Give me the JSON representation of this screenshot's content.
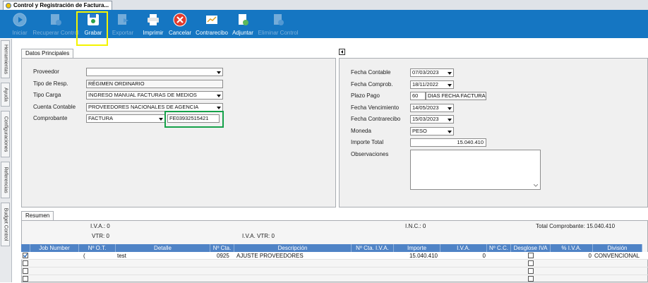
{
  "window": {
    "title": "Control y Registración de Factura..."
  },
  "toolbar": {
    "iniciar": "Iniciar",
    "recuperar": "Recuperar Control",
    "grabar": "Grabar",
    "exportar": "Exportar",
    "imprimir": "Imprimir",
    "cancelar": "Cancelar",
    "contrarecibo": "Contrarecibo",
    "adjuntar": "Adjuntar",
    "eliminar": "Eliminar Control"
  },
  "side_tabs": [
    "Herramientas",
    "Ayuda",
    "Configuraciones",
    "Referencias",
    "Budget Control"
  ],
  "datos": {
    "tab": "Datos Principales",
    "proveedor_label": "Proveedor",
    "proveedor_value": "",
    "tipo_resp_label": "Tipo de Resp.",
    "tipo_resp_value": "RÉGIMEN ORDINARIO",
    "tipo_carga_label": "Tipo Carga",
    "tipo_carga_value": "INGRESO MANUAL FACTURAS DE MEDIOS",
    "cuenta_label": "Cuenta Contable",
    "cuenta_value": "PROVEEDORES NACIONALES DE AGENCIA",
    "comprobante_label": "Comprobante",
    "comprobante_tipo": "FACTURA",
    "comprobante_numero": "FE03932515421"
  },
  "fechas": {
    "fecha_contable_label": "Fecha Contable",
    "fecha_contable": "07/03/2023",
    "fecha_comprob_label": "Fecha Comprob.",
    "fecha_comprob": "18/11/2022",
    "plazo_label": "Plazo Pago",
    "plazo_dias": "60",
    "plazo_desc": "DIAS FECHA FACTURA",
    "vencimiento_label": "Fecha Vencimiento",
    "vencimiento": "14/05/2023",
    "contrarecibo_label": "Fecha Contrarecibo",
    "contrarecibo": "15/03/2023",
    "moneda_label": "Moneda",
    "moneda": "PESO",
    "importe_label": "Importe Total",
    "importe": "15.040.410",
    "observaciones_label": "Observaciones",
    "observaciones": ""
  },
  "resumen": {
    "tab": "Resumen",
    "iva": "I.V.A.: 0",
    "inc": "I.N.C.: 0",
    "total": "Total Comprobante: 15.040.410",
    "vtr": "VTR: 0",
    "iva_vtr": "I.V.A. VTR: 0"
  },
  "grid": {
    "columns": [
      "Job Number",
      "Nº O.T.",
      "Detalle",
      "Nº Cta.",
      "Descripción",
      "Nº Cta. I.V.A.",
      "Importe",
      "I.V.A.",
      "Nº C.C.",
      "Desglose IVA",
      "% I.V.A.",
      "División"
    ],
    "rows": [
      {
        "checked": true,
        "job_number": "",
        "ot": "(",
        "detalle": "test",
        "cta": "0925",
        "descripcion": "AJUSTE PROVEEDORES",
        "cta_iva": "",
        "importe": "15.040.410",
        "iva": "0",
        "cc": "",
        "desglose": false,
        "porc_iva": "0",
        "division": "CONVENCIONAL"
      },
      {
        "checked": false
      },
      {
        "checked": false
      },
      {
        "checked": false
      }
    ]
  },
  "colors": {
    "toolbar": "#1576c2",
    "grid_header": "#4f83c6",
    "highlight_yellow": "#f4f400",
    "highlight_green": "#16a24a"
  }
}
